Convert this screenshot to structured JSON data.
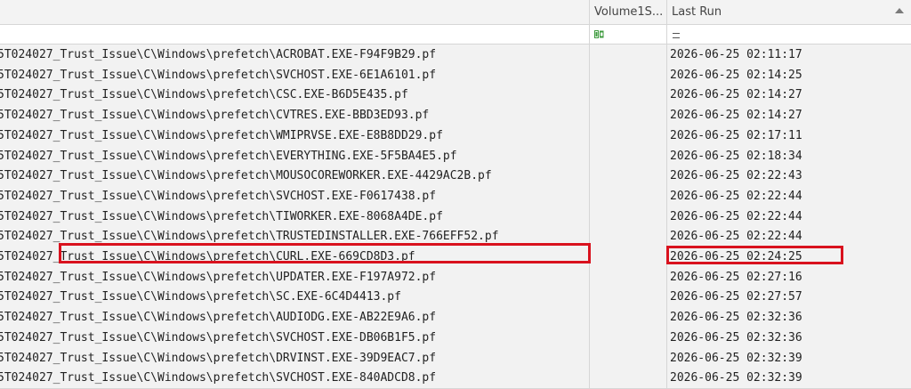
{
  "header": {
    "columns": [
      "Volume1S...",
      "Last Run"
    ],
    "sort_icon": "sort-ascending-icon"
  },
  "filter": {
    "volume_icon": "filter-contains-icon",
    "lastrun_icon": "filter-equals-icon"
  },
  "rows": [
    {
      "path": "5T024027_Trust_Issue\\C\\Windows\\prefetch\\ACROBAT.EXE-F94F9B29.pf",
      "last_run": "2026-06-25 02:11:17"
    },
    {
      "path": "5T024027_Trust_Issue\\C\\Windows\\prefetch\\SVCHOST.EXE-6E1A6101.pf",
      "last_run": "2026-06-25 02:14:25"
    },
    {
      "path": "5T024027_Trust_Issue\\C\\Windows\\prefetch\\CSC.EXE-B6D5E435.pf",
      "last_run": "2026-06-25 02:14:27"
    },
    {
      "path": "5T024027_Trust_Issue\\C\\Windows\\prefetch\\CVTRES.EXE-BBD3ED93.pf",
      "last_run": "2026-06-25 02:14:27"
    },
    {
      "path": "5T024027_Trust_Issue\\C\\Windows\\prefetch\\WMIPRVSE.EXE-E8B8DD29.pf",
      "last_run": "2026-06-25 02:17:11"
    },
    {
      "path": "5T024027_Trust_Issue\\C\\Windows\\prefetch\\EVERYTHING.EXE-5F5BA4E5.pf",
      "last_run": "2026-06-25 02:18:34"
    },
    {
      "path": "5T024027_Trust_Issue\\C\\Windows\\prefetch\\MOUSOCOREWORKER.EXE-4429AC2B.pf",
      "last_run": "2026-06-25 02:22:43"
    },
    {
      "path": "5T024027_Trust_Issue\\C\\Windows\\prefetch\\SVCHOST.EXE-F0617438.pf",
      "last_run": "2026-06-25 02:22:44"
    },
    {
      "path": "5T024027_Trust_Issue\\C\\Windows\\prefetch\\TIWORKER.EXE-8068A4DE.pf",
      "last_run": "2026-06-25 02:22:44"
    },
    {
      "path": "5T024027_Trust_Issue\\C\\Windows\\prefetch\\TRUSTEDINSTALLER.EXE-766EFF52.pf",
      "last_run": "2026-06-25 02:22:44"
    },
    {
      "path": "5T024027_Trust_Issue\\C\\Windows\\prefetch\\CURL.EXE-669CD8D3.pf",
      "last_run": "2026-06-25 02:24:25",
      "highlighted": true
    },
    {
      "path": "5T024027_Trust_Issue\\C\\Windows\\prefetch\\UPDATER.EXE-F197A972.pf",
      "last_run": "2026-06-25 02:27:16"
    },
    {
      "path": "5T024027_Trust_Issue\\C\\Windows\\prefetch\\SC.EXE-6C4D4413.pf",
      "last_run": "2026-06-25 02:27:57"
    },
    {
      "path": "5T024027_Trust_Issue\\C\\Windows\\prefetch\\AUDIODG.EXE-AB22E9A6.pf",
      "last_run": "2026-06-25 02:32:36"
    },
    {
      "path": "5T024027_Trust_Issue\\C\\Windows\\prefetch\\SVCHOST.EXE-DB06B1F5.pf",
      "last_run": "2026-06-25 02:32:36"
    },
    {
      "path": "5T024027_Trust_Issue\\C\\Windows\\prefetch\\DRVINST.EXE-39D9EAC7.pf",
      "last_run": "2026-06-25 02:32:39"
    },
    {
      "path": "5T024027_Trust_Issue\\C\\Windows\\prefetch\\SVCHOST.EXE-840ADCD8.pf",
      "last_run": "2026-06-25 02:32:39"
    }
  ],
  "colors": {
    "highlight": "#d9121e",
    "grid_line": "#d6d6d6",
    "row_bg": "#f2f2f2",
    "filter_icon_green": "#3c9a3c"
  }
}
